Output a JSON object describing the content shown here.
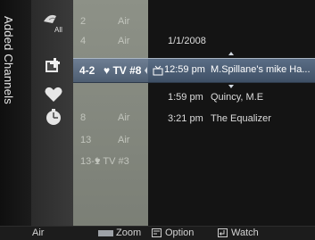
{
  "screen": {
    "title": "Added Channels"
  },
  "filters": [
    {
      "name": "all-filter",
      "icon": "antenna-all-icon",
      "label": "All"
    },
    {
      "name": "added-filter",
      "icon": "add-channel-icon",
      "label": ""
    },
    {
      "name": "favorite-filter",
      "icon": "heart-icon",
      "label": ""
    },
    {
      "name": "timer-filter",
      "icon": "clock-icon",
      "label": ""
    }
  ],
  "channels": [
    {
      "number": "2",
      "name": "Air"
    },
    {
      "number": "4",
      "name": "Air"
    },
    {
      "number": "4-2",
      "name": "♥ TV #8",
      "selected": true
    },
    {
      "number": "8",
      "name": "Air"
    },
    {
      "number": "13",
      "name": "Air"
    },
    {
      "number": "13-1",
      "name": "♥ TV #3"
    }
  ],
  "schedule": {
    "date": "1/1/2008",
    "programs": [
      {
        "time": "12:59 pm",
        "title": "M.Spillane's mike Ha...",
        "current": true,
        "timer_icon": "tv-timer-icon"
      },
      {
        "time": "1:59 pm",
        "title": "Quincy, M.E"
      },
      {
        "time": "3:21 pm",
        "title": "The Equalizer"
      }
    ]
  },
  "bottom_bar": {
    "source": "Air",
    "zoom_label": "Zoom",
    "option_label": "Option",
    "watch_label": "Watch"
  },
  "colors": {
    "highlight": "#5a6d85",
    "channel_column": "#868a81",
    "zoom_key": "#9ea2a7"
  }
}
